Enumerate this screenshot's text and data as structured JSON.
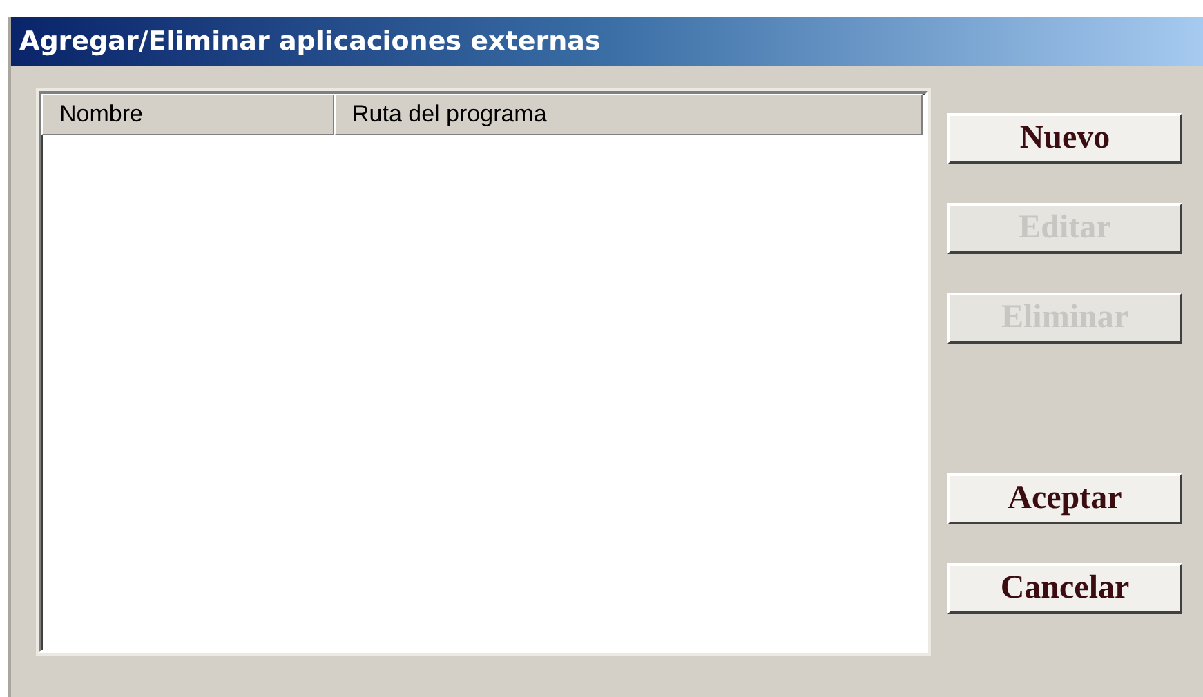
{
  "window": {
    "title": "Agregar/Eliminar aplicaciones externas"
  },
  "list": {
    "columns": [
      "Nombre",
      "Ruta del programa"
    ]
  },
  "buttons": [
    {
      "label": "Nuevo",
      "disabled": false
    },
    {
      "label": "Editar",
      "disabled": true
    },
    {
      "label": "Eliminar",
      "disabled": true
    }
  ],
  "footer_buttons": [
    {
      "label": "Aceptar",
      "disabled": false
    },
    {
      "label": "Cancelar",
      "disabled": false
    }
  ]
}
